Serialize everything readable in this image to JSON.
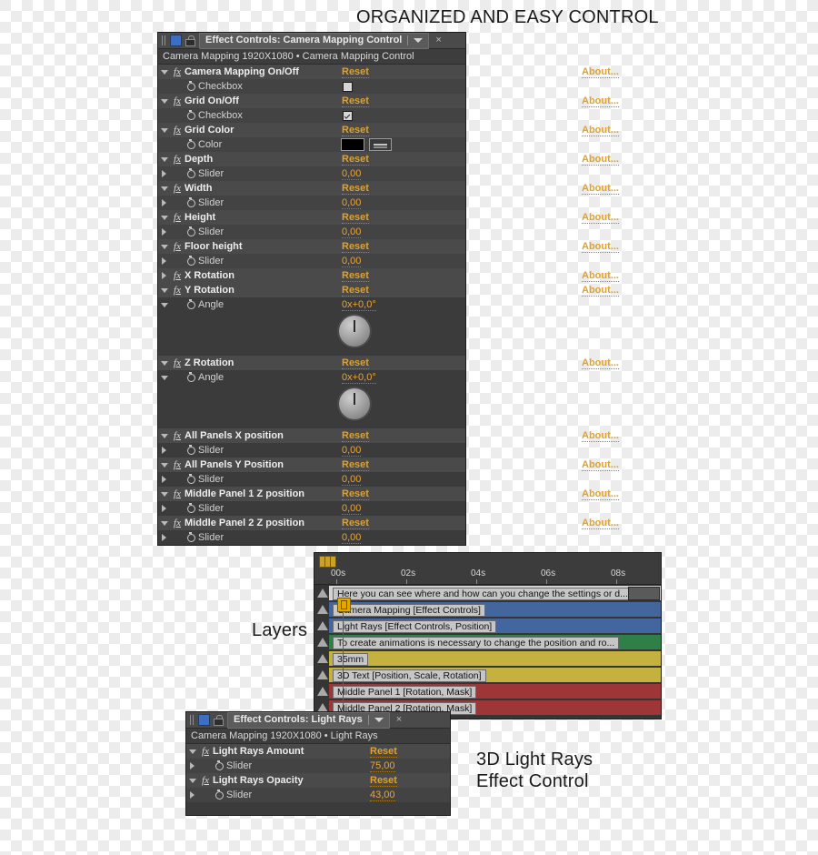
{
  "annotations": {
    "title": "ORGANIZED AND EASY CONTROL",
    "layers": "Layers",
    "light_rays_line1": "3D Light Rays",
    "light_rays_line2": "Effect Control"
  },
  "colors": {
    "accent_orange": "#e0a22c",
    "panel_bg": "#3d3d3d",
    "row_odd": "#3b3b3b",
    "row_even": "#434343",
    "bar_blue": "#43669e",
    "bar_green": "#2f8048",
    "bar_yellow": "#c5b13f",
    "bar_red": "#9e3638",
    "bar_light": "#d3d3d3",
    "playhead_red": "#d22b2b",
    "keyframe_gold": "#c9a227"
  },
  "labels": {
    "reset": "Reset",
    "about": "About...",
    "close": "×"
  },
  "camera_panel": {
    "tab_title": "Effect Controls: Camera Mapping Control",
    "subheader": "Camera Mapping 1920X1080 • Camera Mapping Control",
    "icons": {
      "grip": "grip-icon",
      "square": "composition-icon",
      "lock": "lock-icon",
      "menu": "panel-menu-icon"
    },
    "rows": [
      {
        "kind": "effect",
        "twirl": "down",
        "name": "Camera Mapping On/Off",
        "reset": "Reset",
        "about": "About..."
      },
      {
        "kind": "checkbox",
        "twirl": "none",
        "name": "Checkbox",
        "checked": false
      },
      {
        "kind": "effect",
        "twirl": "down",
        "name": "Grid On/Off",
        "reset": "Reset",
        "about": "About..."
      },
      {
        "kind": "checkbox",
        "twirl": "none",
        "name": "Checkbox",
        "checked": true
      },
      {
        "kind": "effect",
        "twirl": "down",
        "name": "Grid Color",
        "reset": "Reset",
        "about": "About..."
      },
      {
        "kind": "color",
        "twirl": "none",
        "name": "Color",
        "swatch": "#000000"
      },
      {
        "kind": "effect",
        "twirl": "down",
        "name": "Depth",
        "reset": "Reset",
        "about": "About..."
      },
      {
        "kind": "slider",
        "twirl": "right",
        "name": "Slider",
        "value": "0,00"
      },
      {
        "kind": "effect",
        "twirl": "down",
        "name": "Width",
        "reset": "Reset",
        "about": "About..."
      },
      {
        "kind": "slider",
        "twirl": "right",
        "name": "Slider",
        "value": "0,00"
      },
      {
        "kind": "effect",
        "twirl": "down",
        "name": "Height",
        "reset": "Reset",
        "about": "About..."
      },
      {
        "kind": "slider",
        "twirl": "right",
        "name": "Slider",
        "value": "0,00"
      },
      {
        "kind": "effect",
        "twirl": "down",
        "name": "Floor height",
        "reset": "Reset",
        "about": "About..."
      },
      {
        "kind": "slider",
        "twirl": "right",
        "name": "Slider",
        "value": "0,00"
      },
      {
        "kind": "effect",
        "twirl": "right",
        "name": "X Rotation",
        "reset": "Reset",
        "about": "About..."
      },
      {
        "kind": "effect",
        "twirl": "down",
        "name": "Y Rotation",
        "reset": "Reset",
        "about": "About..."
      },
      {
        "kind": "angle",
        "twirl": "down",
        "name": "Angle",
        "value": "0x+0,0°"
      },
      {
        "kind": "dial"
      },
      {
        "kind": "effect",
        "twirl": "down",
        "name": "Z Rotation",
        "reset": "Reset",
        "about": "About..."
      },
      {
        "kind": "angle",
        "twirl": "down",
        "name": "Angle",
        "value": "0x+0,0°"
      },
      {
        "kind": "dial"
      },
      {
        "kind": "effect",
        "twirl": "down",
        "name": "All Panels X position",
        "reset": "Reset",
        "about": "About..."
      },
      {
        "kind": "slider",
        "twirl": "right",
        "name": "Slider",
        "value": "0,00"
      },
      {
        "kind": "effect",
        "twirl": "down",
        "name": "All Panels Y Position",
        "reset": "Reset",
        "about": "About..."
      },
      {
        "kind": "slider",
        "twirl": "right",
        "name": "Slider",
        "value": "0,00"
      },
      {
        "kind": "effect",
        "twirl": "down",
        "name": "Middle Panel 1 Z position",
        "reset": "Reset",
        "about": "About..."
      },
      {
        "kind": "slider",
        "twirl": "right",
        "name": "Slider",
        "value": "0,00"
      },
      {
        "kind": "effect",
        "twirl": "down",
        "name": "Middle Panel 2 Z position",
        "reset": "Reset",
        "about": "About..."
      },
      {
        "kind": "slider",
        "twirl": "right",
        "name": "Slider",
        "value": "0,00"
      }
    ]
  },
  "light_rays_panel": {
    "tab_title": "Effect Controls: Light Rays",
    "subheader": "Camera Mapping 1920X1080 • Light Rays",
    "rows": [
      {
        "kind": "effect",
        "twirl": "down",
        "name": "Light Rays Amount",
        "reset": "Reset"
      },
      {
        "kind": "slider",
        "twirl": "right",
        "name": "Slider",
        "value": "75,00"
      },
      {
        "kind": "effect",
        "twirl": "down",
        "name": "Light Rays Opacity",
        "reset": "Reset"
      },
      {
        "kind": "slider",
        "twirl": "right",
        "name": "Slider",
        "value": "43,00"
      }
    ]
  },
  "timeline": {
    "ruler_ticks": [
      "00s",
      "02s",
      "04s",
      "06s",
      "08s"
    ],
    "playhead_time": "00s",
    "layers": [
      {
        "label": "Here you can see where and how can you change the settings or d...",
        "color": "#d3d3d3",
        "bar_end": 100
      },
      {
        "label": "Camera Mapping [Effect Controls]",
        "color": "#43669e",
        "bar_end": 100
      },
      {
        "label": "Light Rays [Effect Controls, Position]",
        "color": "#43669e",
        "bar_end": 100
      },
      {
        "label": "To create animations is necessary to change the position and ro...",
        "color": "#2f8048",
        "bar_end": 100
      },
      {
        "label": "35mm",
        "color": "#c5b13f",
        "bar_end": 100
      },
      {
        "label": "3D Text [Position, Scale, Rotation]",
        "color": "#c5b13f",
        "bar_end": 100
      },
      {
        "label": "Middle Panel 1 [Rotation, Mask]",
        "color": "#9e3638",
        "bar_end": 100
      },
      {
        "label": "Middle Panel 2 [Rotation, Mask]",
        "color": "#9e3638",
        "bar_end": 100
      }
    ]
  }
}
